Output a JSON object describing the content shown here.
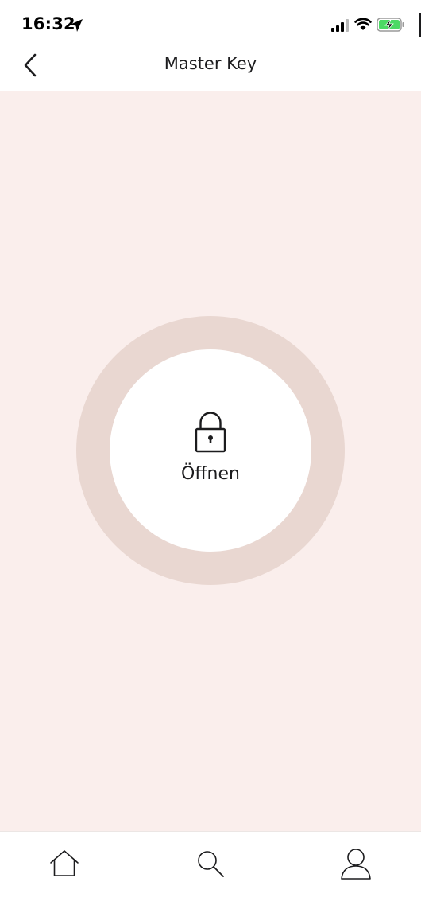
{
  "status_bar": {
    "time": "16:32",
    "icons": [
      "location-arrow-icon",
      "cellular-signal-icon",
      "wifi-icon",
      "battery-charging-icon"
    ],
    "battery_color": "#4cd964"
  },
  "nav": {
    "title": "Master Key",
    "back_icon": "chevron-left-icon"
  },
  "lock": {
    "icon": "padlock-icon",
    "label": "Öffnen"
  },
  "tabs": [
    {
      "name": "home",
      "icon": "house-icon"
    },
    {
      "name": "search",
      "icon": "magnifier-icon"
    },
    {
      "name": "profile",
      "icon": "person-icon"
    }
  ],
  "colors": {
    "background": "#faeeec",
    "ring": "#e9d7d1",
    "button": "#ffffff",
    "text": "#1c1c1e"
  }
}
